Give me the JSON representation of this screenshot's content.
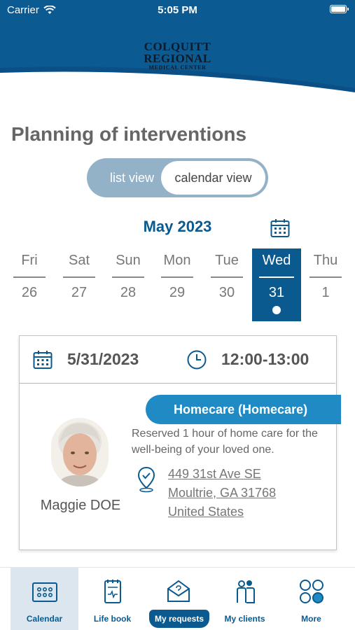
{
  "status_bar": {
    "carrier": "Carrier",
    "time": "5:05 PM"
  },
  "logo": {
    "line1": "COLQUITT",
    "line2": "REGIONAL",
    "line3": "MEDICAL CENTER"
  },
  "page_title": "Planning of interventions",
  "view_toggle": {
    "list_label": "list view",
    "calendar_label": "calendar view",
    "selected": "calendar view"
  },
  "month_label": "May 2023",
  "days": [
    {
      "name": "Fri",
      "number": "26"
    },
    {
      "name": "Sat",
      "number": "27"
    },
    {
      "name": "Sun",
      "number": "28"
    },
    {
      "name": "Mon",
      "number": "29"
    },
    {
      "name": "Tue",
      "number": "30"
    },
    {
      "name": "Wed",
      "number": "31"
    },
    {
      "name": "Thu",
      "number": "1"
    }
  ],
  "selected_day": "31",
  "appointment": {
    "date": "5/31/2023",
    "time": "12:00-13:00",
    "service": "Homecare (Homecare)",
    "client_name": "Maggie DOE",
    "description": "Reserved 1 hour of home care for the well-being of your loved one.",
    "address_line1": "449 31st Ave SE",
    "address_line2": "Moultrie, GA 31768",
    "address_line3": "United States"
  },
  "bottom_nav": [
    {
      "label": "Calendar",
      "icon": "calendar-grid-icon",
      "active": true
    },
    {
      "label": "Life book",
      "icon": "notebook-heart-icon",
      "active": false
    },
    {
      "label": "My requests",
      "icon": "envelope-question-icon",
      "active": false
    },
    {
      "label": "My clients",
      "icon": "people-icon",
      "active": false
    },
    {
      "label": "More",
      "icon": "four-circles-icon",
      "active": false
    }
  ],
  "colors": {
    "brand_blue": "#0a5a8f",
    "accent_blue": "#1f8ac4",
    "toggle_bg": "#93b2c8"
  }
}
